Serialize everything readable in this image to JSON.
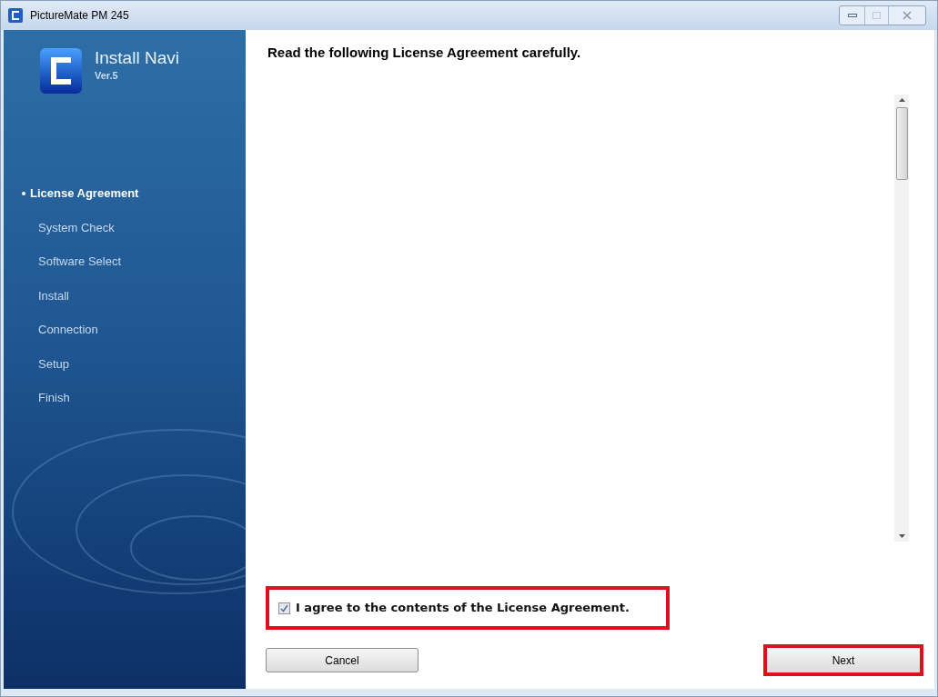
{
  "window": {
    "title": "PictureMate PM 245"
  },
  "sidebar": {
    "app_name": "Install Navi",
    "version": "Ver.5",
    "items": [
      {
        "label": "License Agreement",
        "selected": true
      },
      {
        "label": "System Check",
        "selected": false
      },
      {
        "label": "Software Select",
        "selected": false
      },
      {
        "label": "Install",
        "selected": false
      },
      {
        "label": "Connection",
        "selected": false
      },
      {
        "label": "Setup",
        "selected": false
      },
      {
        "label": "Finish",
        "selected": false
      }
    ]
  },
  "heading": "Read the following License Agreement carefully.",
  "agree": {
    "label": "I agree to the contents of the License Agreement.",
    "checked": true,
    "highlighted": true
  },
  "buttons": [
    {
      "label": "Cancel",
      "highlighted": false
    },
    {
      "label": "Next",
      "highlighted": true
    }
  ]
}
